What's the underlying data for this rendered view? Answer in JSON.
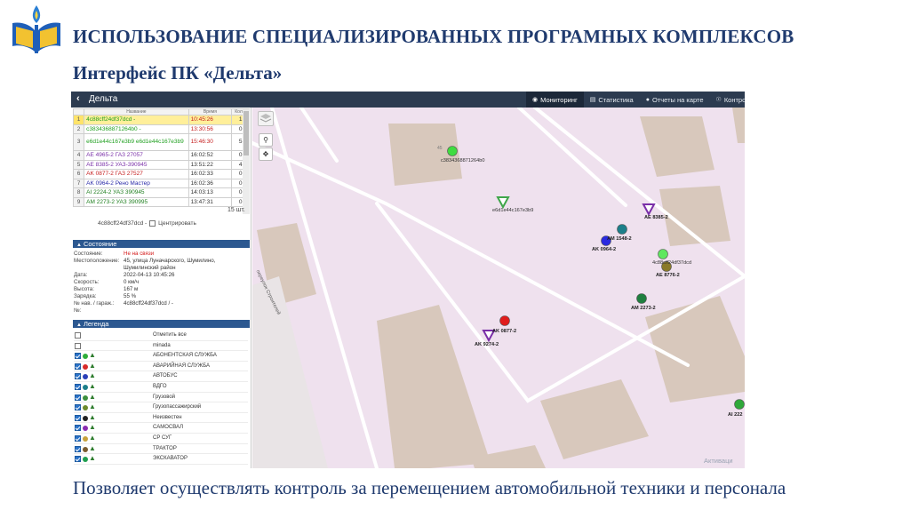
{
  "slide": {
    "title": "ИСПОЛЬЗОВАНИЕ СПЕЦИАЛИЗИРОВАННЫХ ПРОГРАМНЫХ КОМПЛЕКСОВ",
    "subtitle": "Интерфейс ПК «Дельта»",
    "caption": "Позволяет осуществлять контроль за перемещением автомобильной техники и персонала"
  },
  "app": {
    "back_icon": "chevron-left-icon",
    "name": "Дельта",
    "tabs": [
      {
        "label": "Мониторинг",
        "icon": "binoculars-icon",
        "active": true
      },
      {
        "label": "Статистика",
        "icon": "bar-chart-icon",
        "active": false
      },
      {
        "label": "Отчеты на карте",
        "icon": "globe-icon",
        "active": false
      },
      {
        "label": "Контро",
        "icon": "eye-icon",
        "active": false
      }
    ]
  },
  "vehicles": {
    "columns": [
      "Название",
      "Время",
      "Кол-ч"
    ],
    "rows": [
      {
        "num": "1",
        "name": "4c88cff24df37dcd -",
        "time": "10:45:26",
        "count": "1",
        "name_color": "#1f9f1f",
        "time_color": "#c62020",
        "selected": true,
        "tall": false
      },
      {
        "num": "2",
        "name": "c3834368871264b0 -",
        "time": "13:30:56",
        "count": "0",
        "name_color": "#1f9f1f",
        "time_color": "#c62020",
        "selected": false,
        "tall": false
      },
      {
        "num": "3",
        "name": "e6d1e44c167e3b9 e6d1e44c167e3b9",
        "time": "15:46:30",
        "count": "5",
        "name_color": "#1f9f1f",
        "time_color": "#c62020",
        "selected": false,
        "tall": true
      },
      {
        "num": "4",
        "name": "AE 4965-2 ГАЗ 27057",
        "time": "16:02:52",
        "count": "0",
        "name_color": "#7a2fa8",
        "time_color": "#333333",
        "selected": false,
        "tall": false
      },
      {
        "num": "5",
        "name": "AE 8385-2 УАЗ-390945",
        "time": "13:51:22",
        "count": "4",
        "name_color": "#7a2fa8",
        "time_color": "#333333",
        "selected": false,
        "tall": false
      },
      {
        "num": "6",
        "name": "AK 0877-2 ГАЗ 27527",
        "time": "16:02:33",
        "count": "0",
        "name_color": "#c62020",
        "time_color": "#333333",
        "selected": false,
        "tall": false
      },
      {
        "num": "7",
        "name": "AK 0964-2 Рено Мастер",
        "time": "16:02:36",
        "count": "0",
        "name_color": "#2a2aa8",
        "time_color": "#333333",
        "selected": false,
        "tall": false
      },
      {
        "num": "8",
        "name": "AI 2224-2 УАЗ 390945",
        "time": "14:03:13",
        "count": "0",
        "name_color": "#1f7f1f",
        "time_color": "#333333",
        "selected": false,
        "tall": false
      },
      {
        "num": "9",
        "name": "AM 2273-2 УАЗ 390995",
        "time": "13:47:31",
        "count": "0",
        "name_color": "#1f7f1f",
        "time_color": "#333333",
        "selected": false,
        "tall": false
      }
    ],
    "count_label": "15 шт.",
    "selected_name": "4c88cff24df37dcd -",
    "center_label": "Центрировать"
  },
  "state": {
    "header": "Состояние",
    "rows": [
      {
        "key": "Состояние:",
        "value": "Не на связи",
        "alert": true
      },
      {
        "key": "Местоположение:",
        "value": "45, улица Луначарского, Шумилино, Шумилинский район",
        "alert": false
      },
      {
        "key": "Дата:",
        "value": "2022-04-13 10:45:26",
        "alert": false
      },
      {
        "key": "Скорость:",
        "value": "0 км/ч",
        "alert": false
      },
      {
        "key": "Высота:",
        "value": "167 м",
        "alert": false
      },
      {
        "key": "Зарядка:",
        "value": "55 %",
        "alert": false
      },
      {
        "key": "№ нав. / гараж.:",
        "value": "4c88cff24df37dcd / -",
        "alert": false
      },
      {
        "key": "№:",
        "value": "",
        "alert": false
      }
    ]
  },
  "legend": {
    "header": "Легенда",
    "select_all": "Отметить все",
    "items": [
      {
        "label": "minada",
        "color": "",
        "checked": false
      },
      {
        "label": "АБОНЕНТСКАЯ СЛУЖБА",
        "color": "#2fae3a",
        "checked": true
      },
      {
        "label": "АВАРИЙНАЯ СЛУЖБА",
        "color": "#d82a2a",
        "checked": true
      },
      {
        "label": "АВТОБУС",
        "color": "#2a3fb8",
        "checked": true
      },
      {
        "label": "ВДГО",
        "color": "#1c7f8a",
        "checked": true
      },
      {
        "label": "Грузовой",
        "color": "#3d8f3d",
        "checked": true
      },
      {
        "label": "Грузопассажирский",
        "color": "#6d8a2b",
        "checked": true
      },
      {
        "label": "Неизвестен",
        "color": "#222222",
        "checked": true
      },
      {
        "label": "САМОСВАЛ",
        "color": "#8a2bb0",
        "checked": true
      },
      {
        "label": "СР СУГ",
        "color": "#c7a23a",
        "checked": true
      },
      {
        "label": "ТРАКТОР",
        "color": "#7a5c2e",
        "checked": true
      },
      {
        "label": "ЭКСКАВАТОР",
        "color": "#1f9f4f",
        "checked": true
      }
    ]
  },
  "map": {
    "building_number": "45",
    "street_label": "переулок Строителей",
    "watermark": "Активаци",
    "markers": [
      {
        "label": "c3834368871264b0",
        "kind": "dot",
        "color": "#3fdc3f"
      },
      {
        "label": "e6d1e44c167e3b9",
        "kind": "tri",
        "color": "#3fa64a"
      },
      {
        "label": "AE 8385-2",
        "kind": "tri",
        "color": "#7a2fa8"
      },
      {
        "label": "AM 1548-2",
        "kind": "dot",
        "color": "#1c7f8a"
      },
      {
        "label": "AK 0964-2",
        "kind": "dot",
        "color": "#2a2ae0"
      },
      {
        "label": "4c88cff24df37dcd",
        "kind": "dot",
        "color": "#5fe85f"
      },
      {
        "label": "AE 8776-2",
        "kind": "dot",
        "color": "#8a7a2a"
      },
      {
        "label": "AM 2273-2",
        "kind": "dot",
        "color": "#1f7f3f"
      },
      {
        "label": "AK 0877-2",
        "kind": "dot",
        "color": "#e01c1c"
      },
      {
        "label": "AK 9274-2",
        "kind": "tri",
        "color": "#7a2fa8"
      },
      {
        "label": "AI 222",
        "kind": "dot",
        "color": "#2fa83a"
      }
    ]
  },
  "colors": {
    "title": "#1f3a6e",
    "topbar": "#2c3b50",
    "section_header": "#2c5890",
    "map_bg": "#efe1ee",
    "building": "#d8c8bc"
  }
}
